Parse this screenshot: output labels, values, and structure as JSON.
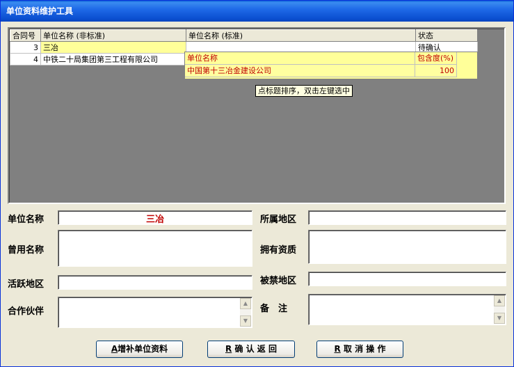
{
  "window": {
    "title": "单位资料维护工具"
  },
  "grid": {
    "columns": [
      "合同号",
      "单位名称 (非标准)",
      "单位名称 (标准)",
      "状态"
    ],
    "rows": [
      {
        "id": "3",
        "name_nonstd": "三冶",
        "name_std": "",
        "status": "待确认"
      },
      {
        "id": "4",
        "name_nonstd": "中铁二十局集团第三工程有限公司",
        "name_std": "",
        "status": ""
      }
    ]
  },
  "match_popup": {
    "headers": [
      "单位名称",
      "包含度(%)"
    ],
    "rows": [
      {
        "name": "中国第十三冶金建设公司",
        "degree": "100"
      }
    ]
  },
  "tooltip": "点标题排序，双击左键选中",
  "form": {
    "unit_name_label": "单位名称",
    "unit_name_value": "三冶",
    "region_label": "所属地区",
    "former_name_label": "曾用名称",
    "qualification_label": "拥有资质",
    "active_region_label": "活跃地区",
    "banned_region_label": "被禁地区",
    "partner_label": "合作伙伴",
    "remark_label": "备　注"
  },
  "buttons": {
    "add": {
      "hotkey": "A",
      "label": "增补单位资料"
    },
    "confirm": {
      "hotkey": "R",
      "label": " 确 认 返 回"
    },
    "cancel": {
      "hotkey": "R",
      "label": " 取 消 操 作"
    }
  }
}
